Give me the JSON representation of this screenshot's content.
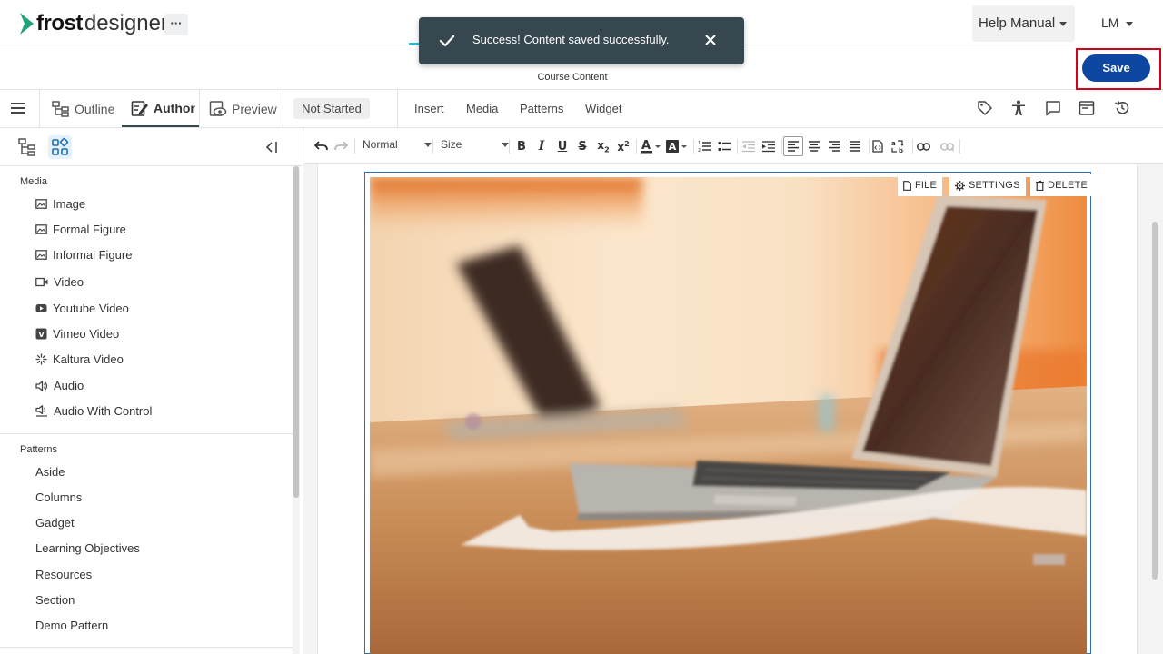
{
  "header": {
    "logo_frost": "frost",
    "logo_designer": "designer",
    "more_label": "···",
    "help_label": "Help Manual",
    "user_initials": "LM"
  },
  "toast": {
    "message": "Success! Content saved successfully."
  },
  "subheader": {
    "title": "Course Content",
    "save_label": "Save"
  },
  "tabs": {
    "outline": "Outline",
    "author": "Author",
    "preview": "Preview",
    "status": "Not Started",
    "menu": [
      "Insert",
      "Media",
      "Patterns",
      "Widget"
    ]
  },
  "left_panel": {
    "media_heading": "Media",
    "media_items": [
      {
        "label": "Image",
        "icon": "image-icon"
      },
      {
        "label": "Formal Figure",
        "icon": "image-icon"
      },
      {
        "label": "Informal Figure",
        "icon": "image-icon"
      },
      {
        "label": "Video",
        "icon": "video-camera-icon"
      },
      {
        "label": "Youtube Video",
        "icon": "youtube-icon"
      },
      {
        "label": "Vimeo Video",
        "icon": "vimeo-icon"
      },
      {
        "label": "Kaltura Video",
        "icon": "kaltura-icon"
      },
      {
        "label": "Audio",
        "icon": "speaker-icon"
      },
      {
        "label": "Audio With Control",
        "icon": "speaker-control-icon"
      }
    ],
    "patterns_heading": "Patterns",
    "pattern_items": [
      "Aside",
      "Columns",
      "Gadget",
      "Learning Objectives",
      "Resources",
      "Section",
      "Demo Pattern"
    ]
  },
  "editor_toolbar": {
    "format_value": "Normal",
    "size_value": "Size"
  },
  "figure_actions": {
    "file": "FILE",
    "settings": "SETTINGS",
    "delete": "DELETE"
  },
  "colors": {
    "brand_green": "#1fa37a",
    "save_blue": "#0d47a1",
    "toast_bg": "#37474f",
    "highlight_red": "#d0021b"
  }
}
